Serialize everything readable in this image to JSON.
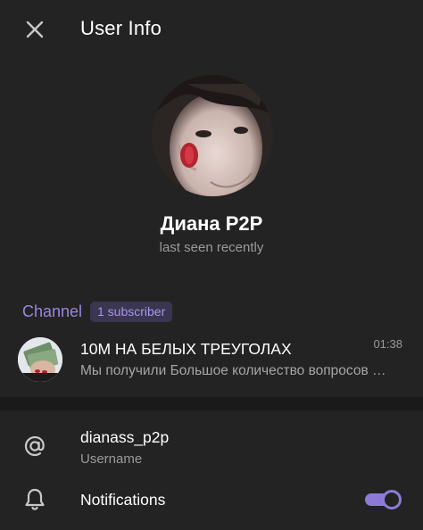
{
  "header": {
    "title": "User Info",
    "close_icon": "close-icon"
  },
  "profile": {
    "name": "Диана P2P",
    "status": "last seen recently",
    "avatar_icon": "user-avatar-photo"
  },
  "channel": {
    "section_label": "Channel",
    "subscriber_badge": "1 subscriber",
    "title": "10M НА БЕЛЫХ ТРЕУГОЛАХ",
    "time": "01:38",
    "preview": "Мы получили Большое количество вопросов …",
    "thumb_icon": "channel-photo"
  },
  "info": {
    "username_value": "dianass_p2p",
    "username_label": "Username",
    "username_icon": "at-sign-icon",
    "notifications_label": "Notifications",
    "notifications_icon": "bell-icon",
    "notifications_enabled": true
  },
  "colors": {
    "background": "#232323",
    "accent": "#8c7bd6",
    "secondary_text": "#9a9a9a",
    "section_divider": "#1a1a1a"
  }
}
